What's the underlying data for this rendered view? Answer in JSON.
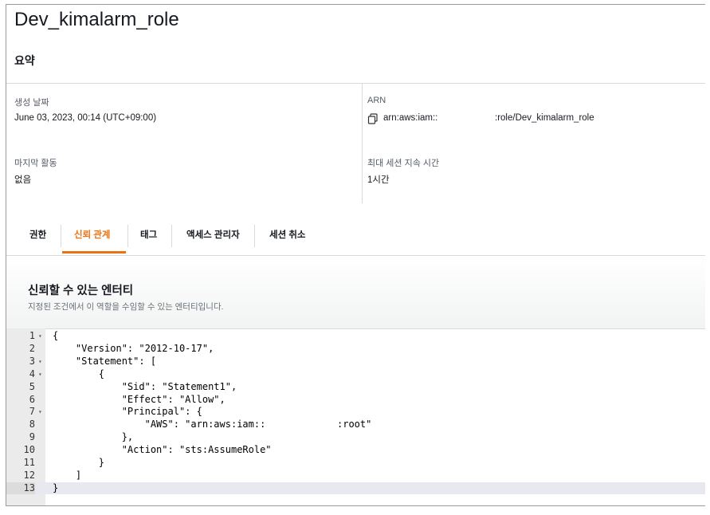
{
  "role": {
    "title": "Dev_kimalarm_role"
  },
  "summary": {
    "heading": "요약",
    "created_label": "생성 날짜",
    "created_value": "June 03, 2023, 00:14 (UTC+09:00)",
    "arn_label": "ARN",
    "arn_prefix": "arn:aws:iam::",
    "arn_suffix": ":role/Dev_kimalarm_role",
    "last_activity_label": "마지막 활동",
    "last_activity_value": "없음",
    "max_session_label": "최대 세션 지속 시간",
    "max_session_value": "1시간"
  },
  "tabs": [
    {
      "label": "권한",
      "active": false
    },
    {
      "label": "신뢰 관계",
      "active": true
    },
    {
      "label": "태그",
      "active": false
    },
    {
      "label": "액세스 관리자",
      "active": false
    },
    {
      "label": "세션 취소",
      "active": false
    }
  ],
  "trust": {
    "title": "신뢰할 수 있는 엔터티",
    "description": "지정된 조건에서 이 역할을 수임할 수 있는 엔터티입니다."
  },
  "editor": {
    "line_numbers": [
      "1",
      "2",
      "3",
      "4",
      "5",
      "6",
      "7",
      "8",
      "9",
      "10",
      "11",
      "12",
      "13"
    ],
    "lines": [
      "{",
      "    \"Version\": \"2012-10-17\",",
      "    \"Statement\": [",
      "        {",
      "            \"Sid\": \"Statement1\",",
      "            \"Effect\": \"Allow\",",
      "            \"Principal\": {",
      "                \"AWS\": \"arn:aws:iam::",
      "            },",
      "            \"Action\": \"sts:AssumeRole\"",
      "        }",
      "    ]",
      "}"
    ],
    "line8_tail": ":root\"",
    "active_line": 13
  },
  "colors": {
    "accent": "#ec7211",
    "border": "#d5dbdb"
  }
}
